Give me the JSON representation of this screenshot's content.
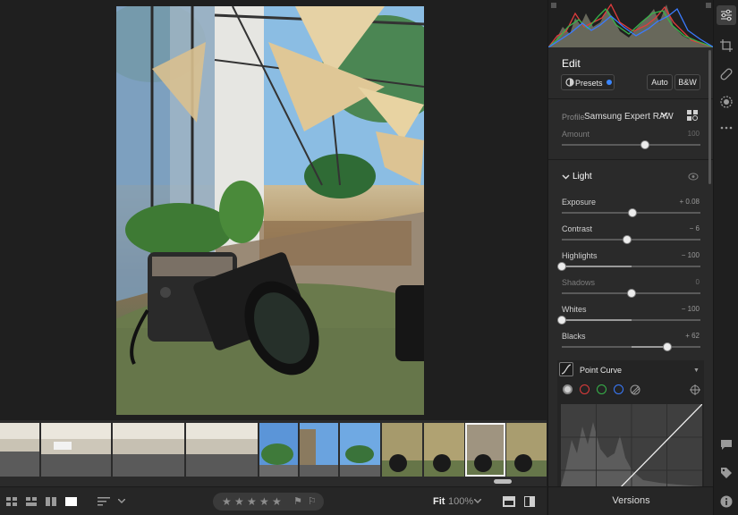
{
  "panel": {
    "title": "Edit",
    "presets_label": "Presets",
    "auto_label": "Auto",
    "bw_label": "B&W",
    "profile_label": "Profile",
    "profile_value": "Samsung Expert RAW",
    "amount": {
      "label": "Amount",
      "value": "100",
      "position": 0.6
    }
  },
  "light": {
    "title": "Light",
    "sliders": [
      {
        "label": "Exposure",
        "value": "+ 0.08",
        "position": 0.51,
        "dim": false
      },
      {
        "label": "Contrast",
        "value": "− 6",
        "position": 0.47,
        "dim": false
      },
      {
        "label": "Highlights",
        "value": "− 100",
        "position": 0.0,
        "dim": false
      },
      {
        "label": "Shadows",
        "value": "0",
        "position": 0.5,
        "dim": true
      },
      {
        "label": "Whites",
        "value": "− 100",
        "position": 0.0,
        "dim": false
      },
      {
        "label": "Blacks",
        "value": "+ 62",
        "position": 0.76,
        "dim": false
      }
    ]
  },
  "curve": {
    "title": "Point Curve"
  },
  "versions_label": "Versions",
  "toolbar": {
    "fit_label": "Fit",
    "zoom_value": "100%"
  },
  "colors": {
    "panel_bg": "#2a2a2a",
    "canvas_bg": "#1f1f1f",
    "accent_blue": "#3a86ff",
    "channel_red": "#e03c3c",
    "channel_green": "#37b34a",
    "channel_blue": "#3a7bff"
  },
  "icons": {
    "rail": [
      "sliders-icon",
      "crop-icon",
      "healing-icon",
      "masking-icon",
      "more-icon",
      "comment-icon",
      "tag-icon",
      "info-icon"
    ],
    "toolbar": [
      "grid-large-icon",
      "grid-small-icon",
      "compare-icon",
      "single-view-icon",
      "sort-icon",
      "chevron-down-icon",
      "before-after-icon",
      "split-view-icon"
    ]
  }
}
